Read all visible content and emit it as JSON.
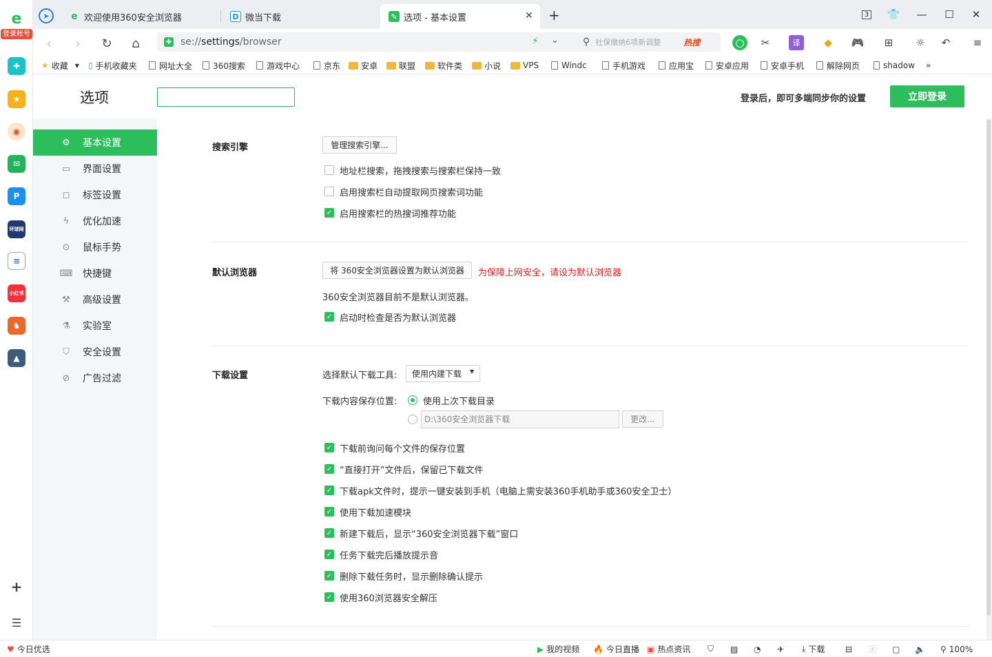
{
  "rail": {
    "login_label": "登录账号",
    "icons": [
      "logo-icon",
      "medical-cross-icon",
      "star-icon",
      "weibo-icon",
      "mail-icon",
      "p-app-icon",
      "world-news-icon",
      "document-icon",
      "xiaohongshu-icon",
      "game-icon",
      "pubg-icon"
    ],
    "xiaohongshu_text": "小红书",
    "news_text": "环球网"
  },
  "tabs": [
    {
      "label": "欢迎使用360安全浏览器",
      "icon": "360-e-icon"
    },
    {
      "label": "微当下载",
      "icon": "weidown-icon"
    },
    {
      "label": "选项 - 基本设置",
      "icon": "settings-tab-icon"
    }
  ],
  "window": {
    "tab_count": "3"
  },
  "address": {
    "url_scheme": "se://",
    "url_bold": "settings",
    "url_rest": "/browser"
  },
  "search": {
    "placeholder": "社保缴纳6项新调整",
    "hot_label": "热搜"
  },
  "toolbar": {
    "translate_label": "译"
  },
  "bookmarks": [
    {
      "label": "收藏",
      "type": "star"
    },
    {
      "label": "手机收藏夹",
      "type": "phone"
    },
    {
      "label": "网址大全",
      "type": "page"
    },
    {
      "label": "360搜索",
      "type": "page"
    },
    {
      "label": "游戏中心",
      "type": "page"
    },
    {
      "label": "京东",
      "type": "page"
    },
    {
      "label": "安卓",
      "type": "folder"
    },
    {
      "label": "联盟",
      "type": "folder"
    },
    {
      "label": "软件类",
      "type": "folder"
    },
    {
      "label": "小说",
      "type": "folder"
    },
    {
      "label": "VPS",
      "type": "folder"
    },
    {
      "label": "Windc",
      "type": "page"
    },
    {
      "label": "手机游戏",
      "type": "page"
    },
    {
      "label": "应用宝",
      "type": "page"
    },
    {
      "label": "安卓应用",
      "type": "page"
    },
    {
      "label": "安卓手机",
      "type": "page"
    },
    {
      "label": "解除网页",
      "type": "page"
    },
    {
      "label": "shadow",
      "type": "page"
    }
  ],
  "bookmarks_more": "»",
  "header": {
    "title": "选项",
    "search_value": "",
    "login_hint": "登录后，即可多端同步你的设置",
    "login_button": "立即登录"
  },
  "sidebar": {
    "items": [
      {
        "label": "基本设置",
        "icon": "gear-icon",
        "active": true
      },
      {
        "label": "界面设置",
        "icon": "window-icon"
      },
      {
        "label": "标签设置",
        "icon": "tab-icon"
      },
      {
        "label": "优化加速",
        "icon": "lightning-icon"
      },
      {
        "label": "鼠标手势",
        "icon": "mouse-icon"
      },
      {
        "label": "快捷键",
        "icon": "keyboard-icon"
      },
      {
        "label": "高级设置",
        "icon": "wrench-icon"
      },
      {
        "label": "实验室",
        "icon": "flask-icon"
      },
      {
        "label": "安全设置",
        "icon": "shield-icon"
      },
      {
        "label": "广告过滤",
        "icon": "block-icon"
      }
    ]
  },
  "search_engine": {
    "title": "搜索引擎",
    "manage_button": "管理搜索引擎...",
    "options": [
      {
        "label": "地址栏搜索，拖拽搜索与搜索栏保持一致",
        "checked": false
      },
      {
        "label": "启用搜索栏自动提取网页搜索词功能",
        "checked": false
      },
      {
        "label": "启用搜索栏的热搜词推荐功能",
        "checked": true
      }
    ]
  },
  "default_browser": {
    "title": "默认浏览器",
    "set_button": "将 360安全浏览器设置为默认浏览器",
    "warning": "为保障上网安全，请设为默认浏览器",
    "status": "360安全浏览器目前不是默认浏览器。",
    "check_option": {
      "label": "启动时检查是否为默认浏览器",
      "checked": true
    }
  },
  "download": {
    "title": "下载设置",
    "tool_label": "选择默认下载工具:",
    "tool_value": "使用内建下载",
    "location_label": "下载内容保存位置:",
    "location_option_last": "使用上次下载目录",
    "location_path": "D:\\360安全浏览器下载",
    "change_button": "更改...",
    "options": [
      {
        "label": "下载前询问每个文件的保存位置",
        "checked": true
      },
      {
        "label": "“直接打开”文件后，保留已下载文件",
        "checked": true
      },
      {
        "label": "下载apk文件时，提示一键安装到手机（电脑上需安装360手机助手或360安全卫士）",
        "checked": true
      },
      {
        "label": "使用下载加速模块",
        "checked": true
      },
      {
        "label": "新建下载后，显示“360安全浏览器下载”窗口",
        "checked": true
      },
      {
        "label": "任务下载完后播放提示音",
        "checked": true
      },
      {
        "label": "删除下载任务时，显示删除确认提示",
        "checked": true
      },
      {
        "label": "使用360浏览器安全解压",
        "checked": true
      }
    ]
  },
  "statusbar": {
    "today_picks": "今日优选",
    "my_video": "我的视频",
    "live": "今日直播",
    "hot_news": "热点资讯",
    "download": "下载",
    "zoom": "100%"
  },
  "colors": {
    "accent": "#2ebd5c",
    "warning": "#e02020",
    "sidebar_bg": "#f5f6f7"
  }
}
